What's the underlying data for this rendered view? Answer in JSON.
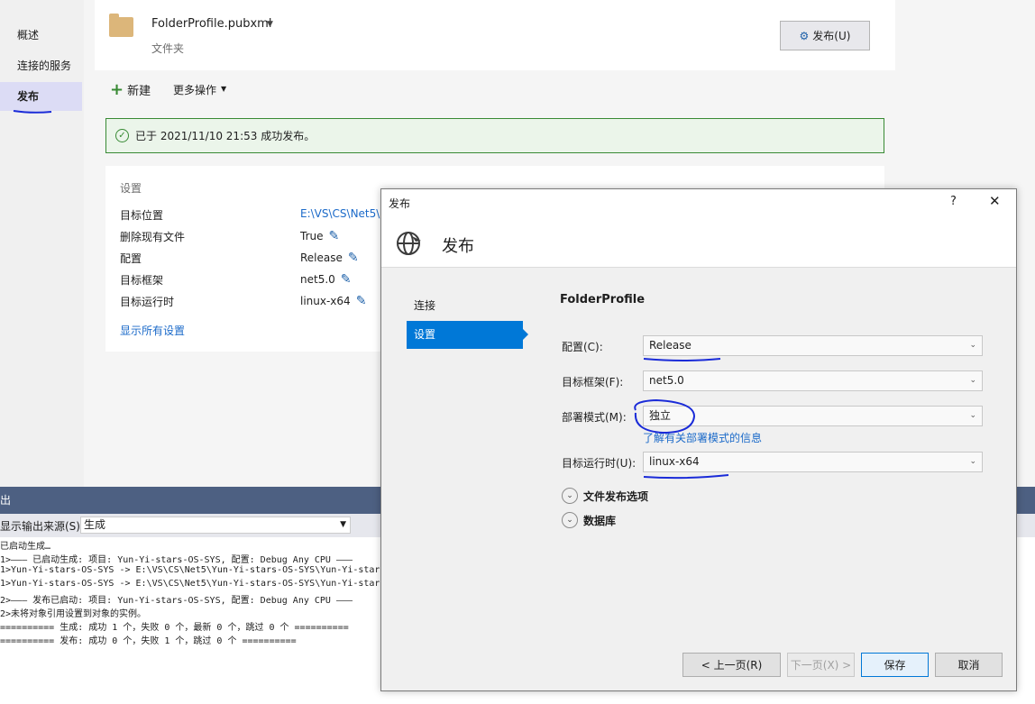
{
  "left_nav": {
    "items": [
      {
        "label": "概述",
        "active": false
      },
      {
        "label": "连接的服务",
        "active": false
      },
      {
        "label": "发布",
        "active": true
      }
    ]
  },
  "profile": {
    "name": "FolderProfile.pubxml",
    "type": "文件夹",
    "publish_button": "发布(U)"
  },
  "toolbar": {
    "new_label": "新建",
    "more_label": "更多操作"
  },
  "status": {
    "message": "已于 2021/11/10 21:53 成功发布。"
  },
  "settings": {
    "title": "设置",
    "rows": [
      {
        "label": "目标位置",
        "value": "E:\\VS\\CS\\Net5\\"
      },
      {
        "label": "删除现有文件",
        "value": "True"
      },
      {
        "label": "配置",
        "value": "Release"
      },
      {
        "label": "目标框架",
        "value": "net5.0"
      },
      {
        "label": "目标运行时",
        "value": "linux-x64"
      }
    ],
    "show_all_link": "显示所有设置"
  },
  "output": {
    "title": "出",
    "source_label": "显示输出来源(S):",
    "source_value": "生成",
    "lines": [
      "已启动生成…",
      "1>——— 已启动生成: 项目: Yun-Yi-stars-OS-SYS, 配置: Debug Any CPU ———",
      "1>Yun-Yi-stars-OS-SYS -> E:\\VS\\CS\\Net5\\Yun-Yi-stars-OS-SYS\\Yun-Yi-stars",
      "1>Yun-Yi-stars-OS-SYS -> E:\\VS\\CS\\Net5\\Yun-Yi-stars-OS-SYS\\Yun-Yi-stars",
      "2>——— 发布已启动: 项目: Yun-Yi-stars-OS-SYS, 配置: Debug Any CPU ———",
      "2>未将对象引用设置到对象的实例。",
      "========== 生成: 成功 1 个，失败 0 个，最新 0 个，跳过 0 个 ==========",
      "========== 发布: 成功 0 个，失败 1 个，跳过 0 个 =========="
    ]
  },
  "dialog": {
    "title": "发布",
    "help": "?",
    "close": "✕",
    "header_title": "发布",
    "steps": [
      {
        "label": "连接",
        "active": false
      },
      {
        "label": "设置",
        "active": true
      }
    ],
    "profile_name": "FolderProfile",
    "fields": [
      {
        "label": "配置(C):",
        "value": "Release"
      },
      {
        "label": "目标框架(F):",
        "value": "net5.0"
      },
      {
        "label": "部署模式(M):",
        "value": "独立"
      },
      {
        "label": "目标运行时(U):",
        "value": "linux-x64"
      }
    ],
    "deploy_link": "了解有关部署模式的信息",
    "expanders": [
      {
        "label": "文件发布选项"
      },
      {
        "label": "数据库"
      }
    ],
    "buttons": {
      "prev": "< 上一页(R)",
      "next": "下一页(X) >",
      "save": "保存",
      "cancel": "取消"
    }
  },
  "colors": {
    "accent": "#0078d7",
    "success": "#388a34",
    "ink": "#1a2bd8"
  }
}
